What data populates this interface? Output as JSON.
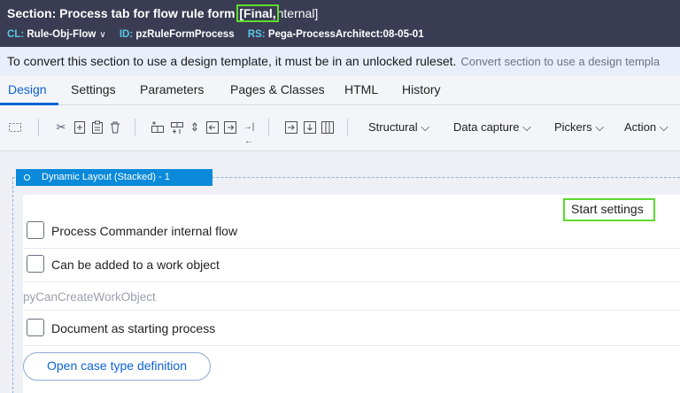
{
  "header": {
    "title_prefix": "Section: Process tab for flow rule form",
    "title_highlight": "[Final,",
    "title_suffix": "nternal]",
    "class_key": "CL:",
    "class_value": "Rule-Obj-Flow",
    "id_key": "ID:",
    "id_value": "pzRuleFormProcess",
    "rs_key": "RS:",
    "rs_value": "Pega-ProcessArchitect:08-05-01"
  },
  "notice": {
    "message": "To convert this section to use a design template, it must be in an unlocked ruleset.",
    "link": "Convert section to use a design templa"
  },
  "tabs": [
    {
      "label": "Design"
    },
    {
      "label": "Settings"
    },
    {
      "label": "Parameters"
    },
    {
      "label": "Pages & Classes"
    },
    {
      "label": "HTML"
    },
    {
      "label": "History"
    }
  ],
  "toolbar": {
    "icons": [
      "select-icon",
      "cut-icon",
      "add-icon",
      "paste-icon",
      "delete-icon",
      "insert-row-icon",
      "insert-column-icon",
      "move-icon",
      "indent-left-icon",
      "indent-right-icon",
      "collapse-icon",
      "embed-icon",
      "align-icon",
      "columns-icon"
    ],
    "menus": [
      {
        "label": "Structural"
      },
      {
        "label": "Data capture"
      },
      {
        "label": "Pickers"
      },
      {
        "label": "Action"
      }
    ]
  },
  "layout": {
    "badge": "Dynamic Layout (Stacked) -   1",
    "start_settings": "Start settings",
    "checkboxes": [
      {
        "label": "Process Commander internal flow",
        "checked": false
      },
      {
        "label": "Can be added to a work object",
        "checked": false
      },
      {
        "label": "Document as starting process",
        "checked": false
      }
    ],
    "property": "pyCanCreateWorkObject",
    "button": "Open case type definition"
  },
  "colors": {
    "header_bg": "#3a3c53",
    "accent": "#0b62d6",
    "highlight": "#5ddc2e",
    "badge_bg": "#0a8ad9"
  }
}
